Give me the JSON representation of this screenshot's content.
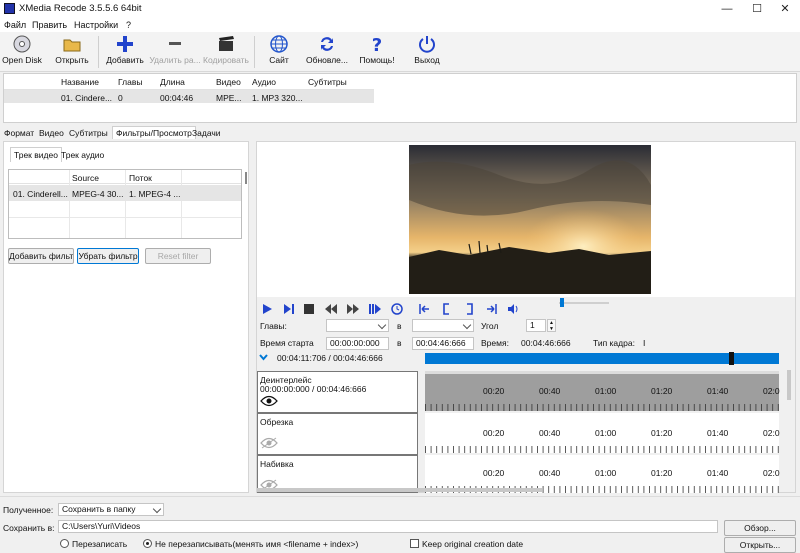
{
  "window": {
    "title": "XMedia Recode 3.5.5.6 64bit",
    "controls": {
      "minimize": "—",
      "maximize": "☐",
      "close": "✕"
    }
  },
  "menu": [
    "Файл",
    "Править",
    "Настройки",
    "?"
  ],
  "toolbar": {
    "open_disk": "Open Disk",
    "open": "Открыть",
    "add": "Добавить",
    "remove": "Удалить ра...",
    "encode": "Кодировать",
    "site": "Сайт",
    "update": "Обновле...",
    "help": "Помощь!",
    "exit": "Выход"
  },
  "file_list": {
    "headers": [
      "Название",
      "Главы",
      "Длина",
      "Видео",
      "Аудио",
      "Субтитры"
    ],
    "row": [
      "01. Cindere...",
      "0",
      "00:04:46",
      "MPE...",
      "1. MP3 320...",
      ""
    ]
  },
  "tabs": [
    "Формат",
    "Видео",
    "Субтитры",
    "Фильтры/Просмотр",
    "Задачи"
  ],
  "active_tab": "Фильтры/Просмотр",
  "left": {
    "subtabs": [
      "Трек видео",
      "Трек аудио"
    ],
    "table": {
      "headers": [
        "",
        "Source",
        "Поток"
      ],
      "row": [
        "01. Cinderell...",
        "MPEG-4 30...",
        "1. MPEG-4 ..."
      ]
    },
    "buttons": {
      "add_filter": "Добавить фильтр",
      "remove_filter": "Убрать фильтр",
      "reset_filter": "Reset filter"
    }
  },
  "preview": {
    "chapters_label": "Главы:",
    "in1": "в",
    "angle_label": "Угол",
    "angle_value": "1",
    "start_label": "Время старта",
    "start_value": "00:00:00:000",
    "in2": "в",
    "end_value": "00:04:46:666",
    "time_label": "Время:",
    "time_value": "00:04:46:666",
    "frame_type_label": "Тип кадра:",
    "frame_type_value": "I",
    "position": "00:04:11:706 / 00:04:46:666"
  },
  "timeline": {
    "tracks": [
      {
        "name": "Деинтерлейс",
        "range": "00:00:00:000 / 00:04:46:666"
      },
      {
        "name": "Обрезка",
        "range": ""
      },
      {
        "name": "Набивка",
        "range": ""
      }
    ],
    "ticks": [
      "00:20",
      "00:40",
      "01:00",
      "01:20",
      "01:40",
      "02:0"
    ]
  },
  "bottom": {
    "received_label": "Полученное:",
    "received_value": "Сохранить в папку",
    "save_to_label": "Сохранить в:",
    "save_path": "C:\\Users\\Yuri\\Videos",
    "browse": "Обзор...",
    "overwrite": "Перезаписать",
    "no_overwrite": "Не перезаписывать(менять имя <filename + index>)",
    "keep_date": "Keep original creation date",
    "open_btn": "Открыть..."
  }
}
